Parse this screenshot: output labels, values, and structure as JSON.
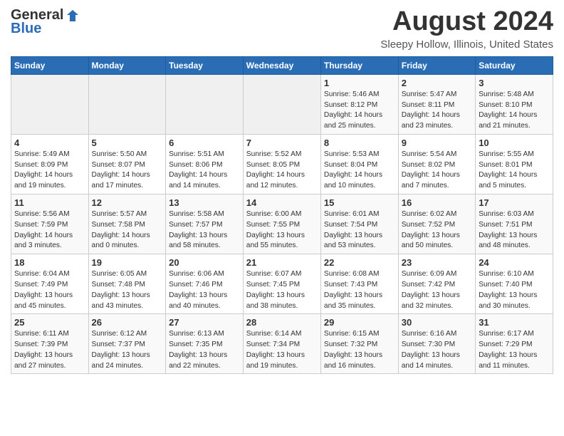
{
  "header": {
    "logo_line1": "General",
    "logo_line2": "Blue",
    "month_year": "August 2024",
    "location": "Sleepy Hollow, Illinois, United States"
  },
  "days_of_week": [
    "Sunday",
    "Monday",
    "Tuesday",
    "Wednesday",
    "Thursday",
    "Friday",
    "Saturday"
  ],
  "weeks": [
    [
      {
        "day": "",
        "detail": ""
      },
      {
        "day": "",
        "detail": ""
      },
      {
        "day": "",
        "detail": ""
      },
      {
        "day": "",
        "detail": ""
      },
      {
        "day": "1",
        "detail": "Sunrise: 5:46 AM\nSunset: 8:12 PM\nDaylight: 14 hours\nand 25 minutes."
      },
      {
        "day": "2",
        "detail": "Sunrise: 5:47 AM\nSunset: 8:11 PM\nDaylight: 14 hours\nand 23 minutes."
      },
      {
        "day": "3",
        "detail": "Sunrise: 5:48 AM\nSunset: 8:10 PM\nDaylight: 14 hours\nand 21 minutes."
      }
    ],
    [
      {
        "day": "4",
        "detail": "Sunrise: 5:49 AM\nSunset: 8:09 PM\nDaylight: 14 hours\nand 19 minutes."
      },
      {
        "day": "5",
        "detail": "Sunrise: 5:50 AM\nSunset: 8:07 PM\nDaylight: 14 hours\nand 17 minutes."
      },
      {
        "day": "6",
        "detail": "Sunrise: 5:51 AM\nSunset: 8:06 PM\nDaylight: 14 hours\nand 14 minutes."
      },
      {
        "day": "7",
        "detail": "Sunrise: 5:52 AM\nSunset: 8:05 PM\nDaylight: 14 hours\nand 12 minutes."
      },
      {
        "day": "8",
        "detail": "Sunrise: 5:53 AM\nSunset: 8:04 PM\nDaylight: 14 hours\nand 10 minutes."
      },
      {
        "day": "9",
        "detail": "Sunrise: 5:54 AM\nSunset: 8:02 PM\nDaylight: 14 hours\nand 7 minutes."
      },
      {
        "day": "10",
        "detail": "Sunrise: 5:55 AM\nSunset: 8:01 PM\nDaylight: 14 hours\nand 5 minutes."
      }
    ],
    [
      {
        "day": "11",
        "detail": "Sunrise: 5:56 AM\nSunset: 7:59 PM\nDaylight: 14 hours\nand 3 minutes."
      },
      {
        "day": "12",
        "detail": "Sunrise: 5:57 AM\nSunset: 7:58 PM\nDaylight: 14 hours\nand 0 minutes."
      },
      {
        "day": "13",
        "detail": "Sunrise: 5:58 AM\nSunset: 7:57 PM\nDaylight: 13 hours\nand 58 minutes."
      },
      {
        "day": "14",
        "detail": "Sunrise: 6:00 AM\nSunset: 7:55 PM\nDaylight: 13 hours\nand 55 minutes."
      },
      {
        "day": "15",
        "detail": "Sunrise: 6:01 AM\nSunset: 7:54 PM\nDaylight: 13 hours\nand 53 minutes."
      },
      {
        "day": "16",
        "detail": "Sunrise: 6:02 AM\nSunset: 7:52 PM\nDaylight: 13 hours\nand 50 minutes."
      },
      {
        "day": "17",
        "detail": "Sunrise: 6:03 AM\nSunset: 7:51 PM\nDaylight: 13 hours\nand 48 minutes."
      }
    ],
    [
      {
        "day": "18",
        "detail": "Sunrise: 6:04 AM\nSunset: 7:49 PM\nDaylight: 13 hours\nand 45 minutes."
      },
      {
        "day": "19",
        "detail": "Sunrise: 6:05 AM\nSunset: 7:48 PM\nDaylight: 13 hours\nand 43 minutes."
      },
      {
        "day": "20",
        "detail": "Sunrise: 6:06 AM\nSunset: 7:46 PM\nDaylight: 13 hours\nand 40 minutes."
      },
      {
        "day": "21",
        "detail": "Sunrise: 6:07 AM\nSunset: 7:45 PM\nDaylight: 13 hours\nand 38 minutes."
      },
      {
        "day": "22",
        "detail": "Sunrise: 6:08 AM\nSunset: 7:43 PM\nDaylight: 13 hours\nand 35 minutes."
      },
      {
        "day": "23",
        "detail": "Sunrise: 6:09 AM\nSunset: 7:42 PM\nDaylight: 13 hours\nand 32 minutes."
      },
      {
        "day": "24",
        "detail": "Sunrise: 6:10 AM\nSunset: 7:40 PM\nDaylight: 13 hours\nand 30 minutes."
      }
    ],
    [
      {
        "day": "25",
        "detail": "Sunrise: 6:11 AM\nSunset: 7:39 PM\nDaylight: 13 hours\nand 27 minutes."
      },
      {
        "day": "26",
        "detail": "Sunrise: 6:12 AM\nSunset: 7:37 PM\nDaylight: 13 hours\nand 24 minutes."
      },
      {
        "day": "27",
        "detail": "Sunrise: 6:13 AM\nSunset: 7:35 PM\nDaylight: 13 hours\nand 22 minutes."
      },
      {
        "day": "28",
        "detail": "Sunrise: 6:14 AM\nSunset: 7:34 PM\nDaylight: 13 hours\nand 19 minutes."
      },
      {
        "day": "29",
        "detail": "Sunrise: 6:15 AM\nSunset: 7:32 PM\nDaylight: 13 hours\nand 16 minutes."
      },
      {
        "day": "30",
        "detail": "Sunrise: 6:16 AM\nSunset: 7:30 PM\nDaylight: 13 hours\nand 14 minutes."
      },
      {
        "day": "31",
        "detail": "Sunrise: 6:17 AM\nSunset: 7:29 PM\nDaylight: 13 hours\nand 11 minutes."
      }
    ]
  ]
}
